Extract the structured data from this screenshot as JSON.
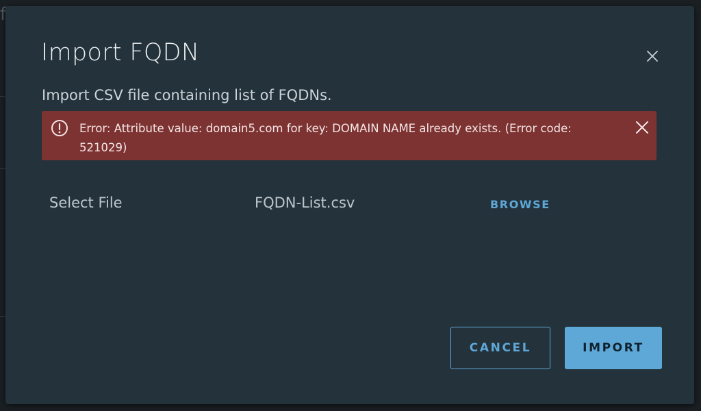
{
  "dialog": {
    "title": "Import FQDN",
    "subtitle": "Import CSV file containing list of FQDNs.",
    "close_icon": "close-icon"
  },
  "alert": {
    "type": "error",
    "icon": "exclamation-circle-icon",
    "message": "Error: Attribute value: domain5.com for key: DOMAIN NAME already exists. (Error code: 521029)",
    "color": "#7e3333"
  },
  "file": {
    "label": "Select File",
    "selected": "FQDN-List.csv",
    "browse_label": "BROWSE"
  },
  "buttons": {
    "cancel_label": "CANCEL",
    "import_label": "IMPORT",
    "accent": "#5ea8d8"
  }
}
